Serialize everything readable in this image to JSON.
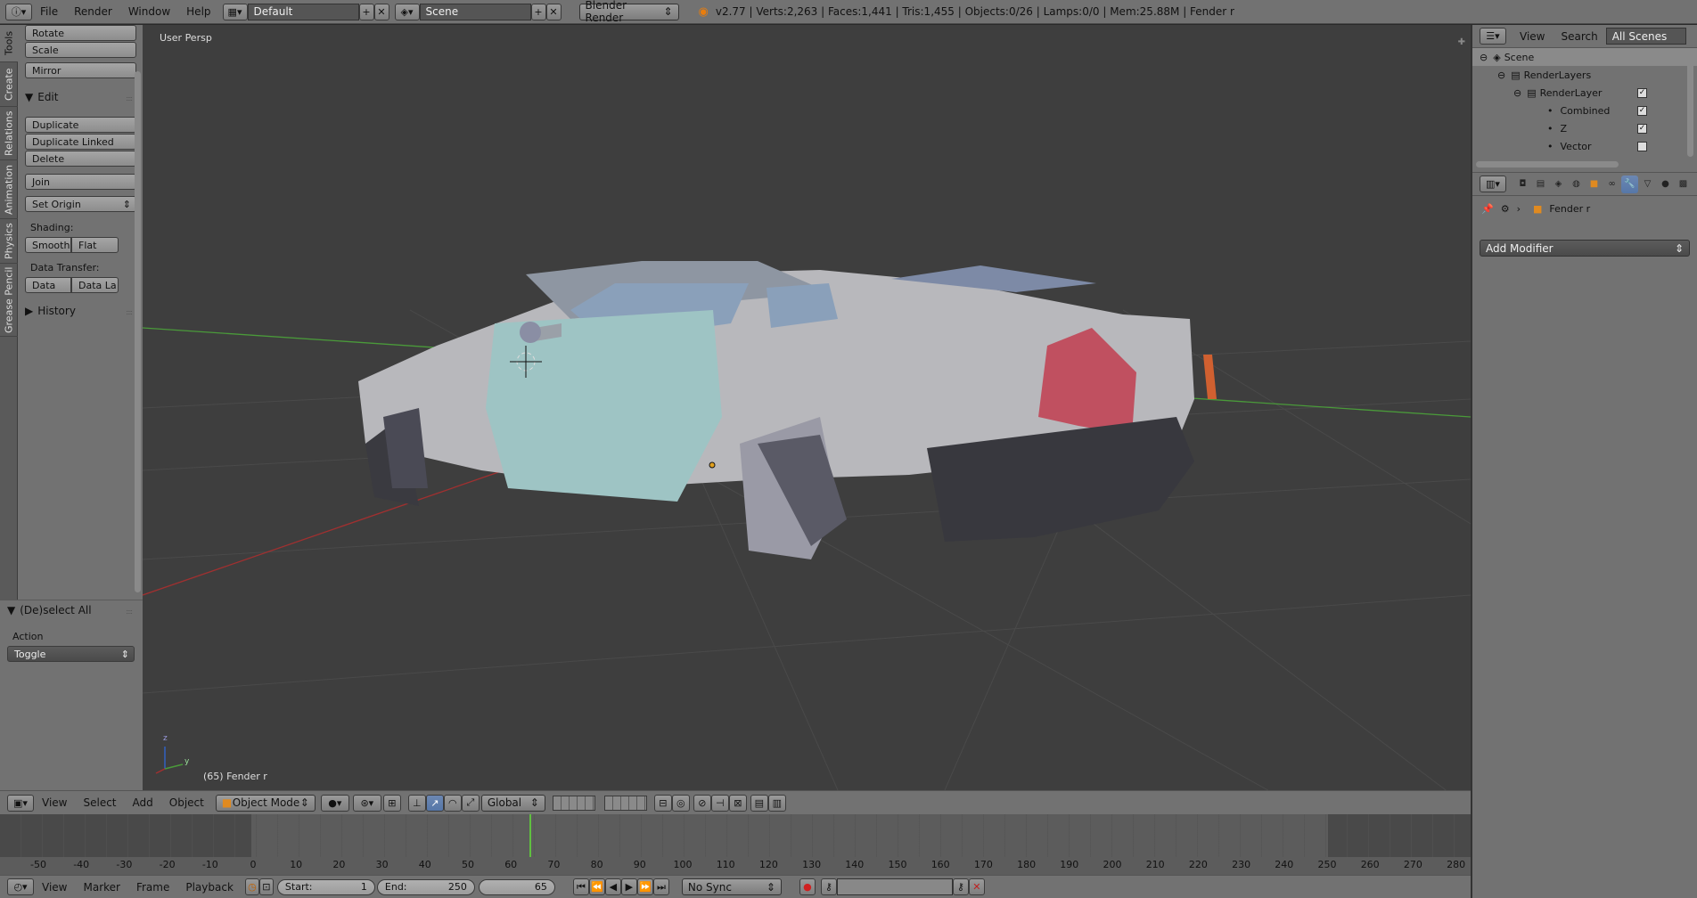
{
  "topbar": {
    "menus": [
      "File",
      "Render",
      "Window",
      "Help"
    ],
    "screen_layout": "Default",
    "scene": "Scene",
    "render_engine": "Blender Render",
    "stats": "v2.77 | Verts:2,263 | Faces:1,441 | Tris:1,455 | Objects:0/26 | Lamps:0/0 | Mem:25.88M | Fender r"
  },
  "tool_tabs": [
    "Tools",
    "Create",
    "Relations",
    "Animation",
    "Physics",
    "Grease Pencil"
  ],
  "toolshelf": {
    "transform_buttons": [
      "Rotate",
      "Scale"
    ],
    "mirror": "Mirror",
    "edit_header": "Edit",
    "edit_buttons": [
      "Duplicate",
      "Duplicate Linked",
      "Delete"
    ],
    "join": "Join",
    "set_origin": "Set Origin",
    "shading_label": "Shading:",
    "shading_smooth": "Smooth",
    "shading_flat": "Flat",
    "data_transfer_label": "Data Transfer:",
    "data": "Data",
    "data_layout": "Data La",
    "history_header": "History"
  },
  "operator_panel": {
    "title": "(De)select All",
    "action_label": "Action",
    "action_value": "Toggle"
  },
  "viewport": {
    "view_name": "User Persp",
    "object_info": "(65) Fender r",
    "axis_labels": {
      "x": "x",
      "y": "y",
      "z": "z"
    },
    "colors": {
      "background": "#3e3e3e",
      "x_axis": "#a03030",
      "y_axis": "#4a9a3a",
      "door": "#9ec4c4",
      "taillight": "#c05060"
    }
  },
  "view3d_header": {
    "menus": [
      "View",
      "Select",
      "Add",
      "Object"
    ],
    "mode": "Object Mode",
    "orientation": "Global"
  },
  "timeline": {
    "tick_labels": [
      "-50",
      "-40",
      "-30",
      "-20",
      "-10",
      "0",
      "10",
      "20",
      "30",
      "40",
      "50",
      "60",
      "70",
      "80",
      "90",
      "100",
      "110",
      "120",
      "130",
      "140",
      "150",
      "160",
      "170",
      "180",
      "190",
      "200",
      "210",
      "220",
      "230",
      "240",
      "250",
      "260",
      "270",
      "280"
    ],
    "current_frame_marker": 65
  },
  "timeline_header": {
    "menus": [
      "View",
      "Marker",
      "Frame",
      "Playback"
    ],
    "start_label": "Start:",
    "start_value": "1",
    "end_label": "End:",
    "end_value": "250",
    "current_frame": "65",
    "sync": "No Sync"
  },
  "outliner": {
    "menus": [
      "View",
      "Search"
    ],
    "filter": "All Scenes",
    "tree": [
      {
        "label": "Scene",
        "checked": null
      },
      {
        "label": "RenderLayers",
        "checked": null
      },
      {
        "label": "RenderLayer",
        "checked": true
      },
      {
        "label": "Combined",
        "checked": true
      },
      {
        "label": "Z",
        "checked": true
      },
      {
        "label": "Vector",
        "checked": false
      }
    ]
  },
  "properties": {
    "object_name": "Fender r",
    "add_modifier": "Add Modifier"
  }
}
